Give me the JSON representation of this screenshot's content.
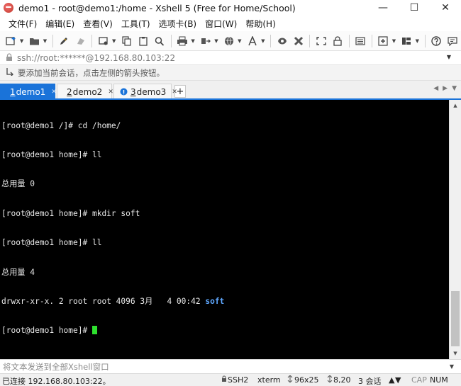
{
  "window": {
    "title": "demo1 - root@demo1:/home - Xshell 5 (Free for Home/School)",
    "controls": {
      "minimize": "—",
      "maximize": "☐",
      "close": "✕"
    }
  },
  "menu": [
    "文件(F)",
    "编辑(E)",
    "查看(V)",
    "工具(T)",
    "选项卡(B)",
    "窗口(W)",
    "帮助(H)"
  ],
  "toolbar": {
    "icons": [
      "new-session-icon",
      "open-folder-icon",
      "pen-icon",
      "eraser-icon",
      "properties-icon",
      "copy-icon",
      "paste-icon",
      "find-icon",
      "print-icon",
      "transfer-icon",
      "globe-icon",
      "font-icon",
      "xftp-icon",
      "xmanager-icon",
      "fullscreen-icon",
      "lock-icon",
      "keyboard-icon",
      "add-icon",
      "layout-icon",
      "help-icon",
      "chat-icon"
    ]
  },
  "address": {
    "value": "ssh://root:******@192.168.80.103:22"
  },
  "hint": {
    "text": "要添加当前会话，点击左侧的箭头按钮。"
  },
  "tabs": [
    {
      "num": "1",
      "label": "demo1",
      "status_color": "#ffffff",
      "active": true
    },
    {
      "num": "2",
      "label": "demo2",
      "status_color": "#22b14c",
      "active": false
    },
    {
      "num": "3",
      "label": "demo3",
      "status_color": "#1a73d9",
      "active": false
    }
  ],
  "terminal": {
    "lines": [
      "[root@demo1 /]# cd /home/",
      "[root@demo1 home]# ll",
      "总用量 0",
      "[root@demo1 home]# mkdir soft",
      "[root@demo1 home]# ll",
      "总用量 4"
    ],
    "listing_prefix": "drwxr-xr-x. 2 root root 4096 3月   4 00:42 ",
    "listing_name": "soft",
    "prompt": "[root@demo1 home]# "
  },
  "compose": {
    "placeholder": "将文本发送到全部Xshell窗口"
  },
  "status": {
    "connection": "已连接 192.168.80.103:22。",
    "protocol": "SSH2",
    "terminal_type": "xterm",
    "size": "96x25",
    "cursor_pos": "8,20",
    "sessions": "3 会话",
    "cap": "CAP",
    "num": "NUM"
  }
}
